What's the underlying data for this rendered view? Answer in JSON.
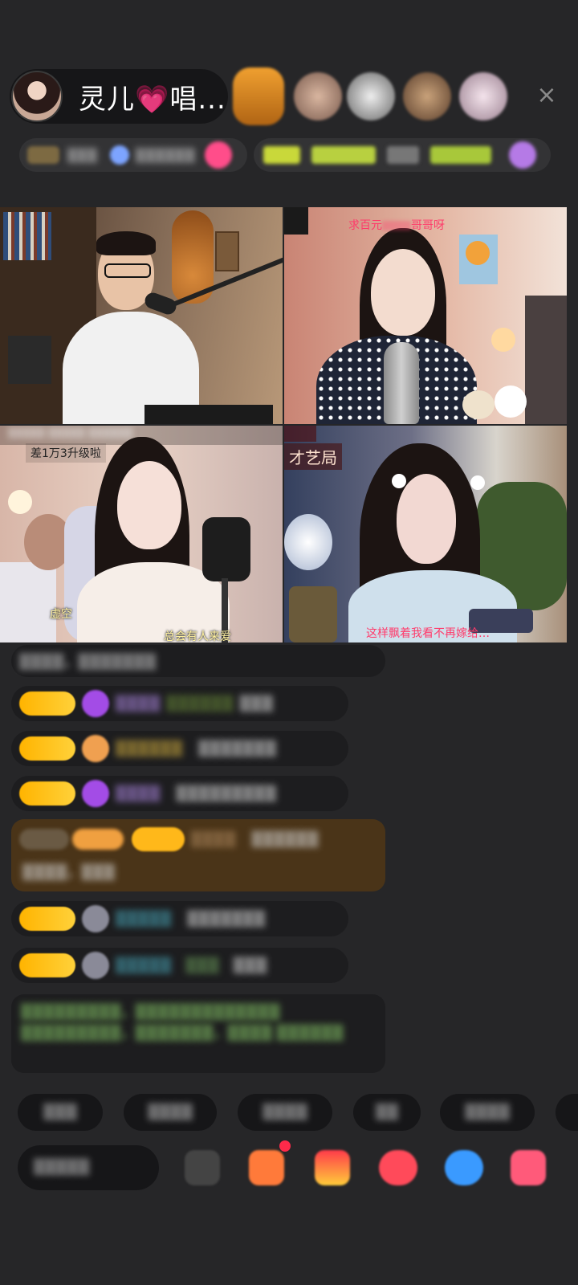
{
  "header": {
    "host_name": "灵儿",
    "host_heart": "💗",
    "host_suffix": "唱...",
    "close_icon": "×"
  },
  "video": {
    "tl_caption": "",
    "tr_caption": "求百元",
    "tr_caption_tail": "哥哥呀",
    "bl_badge": "差1万3升级啦",
    "bl_sub1": "虚空",
    "bl_sub2": "总会有人来爱",
    "br_badge": "才艺局",
    "br_sub": "这样飘着我看不再嫁给…"
  },
  "colors": {
    "background": "#262628",
    "level_badge": "#ffc21a",
    "accent_pink": "#ff5ea8"
  }
}
